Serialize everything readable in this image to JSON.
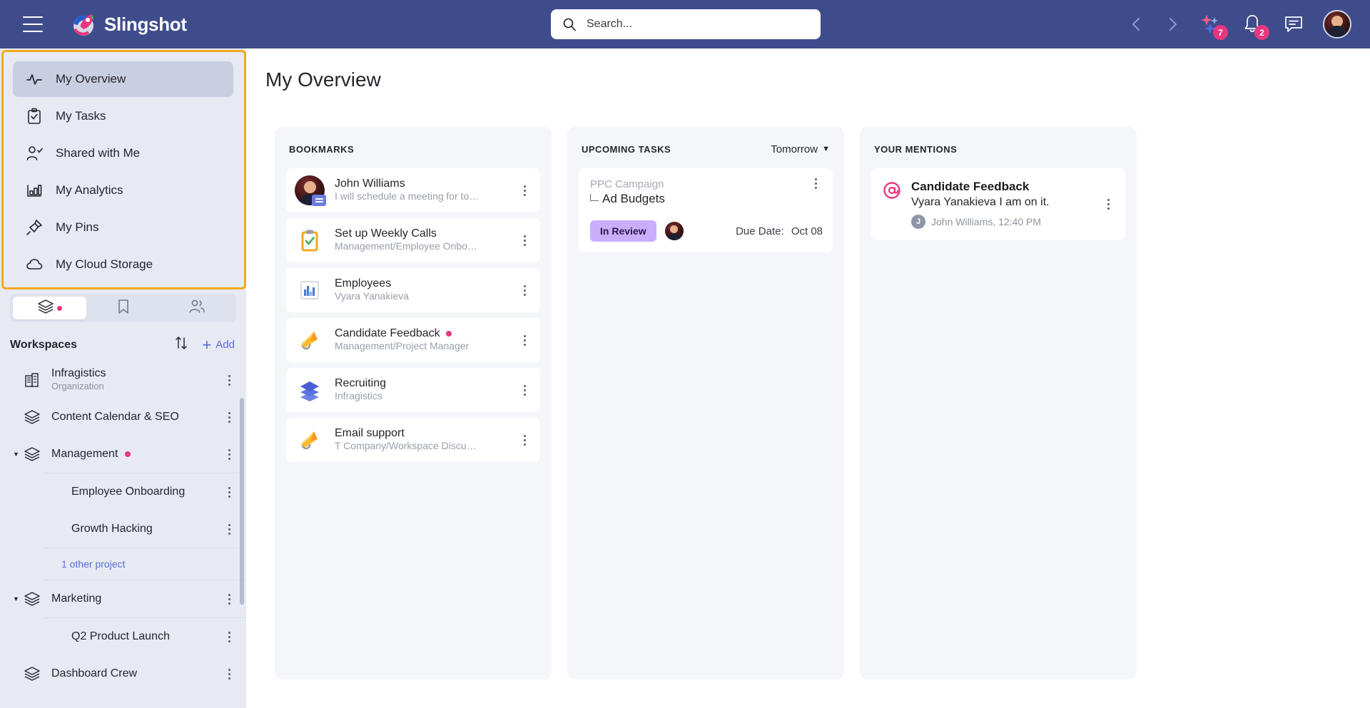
{
  "header": {
    "brand": "Slingshot",
    "menu_icon": "hamburger-icon",
    "search_placeholder": "Search...",
    "ai_badge": "7",
    "notification_badge": "2"
  },
  "sidebar": {
    "nav_items": [
      {
        "label": "My Overview",
        "icon": "activity-icon",
        "active": true
      },
      {
        "label": "My Tasks",
        "icon": "clipboard-check-icon",
        "active": false
      },
      {
        "label": "Shared with Me",
        "icon": "user-check-icon",
        "active": false
      },
      {
        "label": "My Analytics",
        "icon": "bar-chart-icon",
        "active": false
      },
      {
        "label": "My Pins",
        "icon": "pin-icon",
        "active": false
      },
      {
        "label": "My Cloud Storage",
        "icon": "cloud-icon",
        "active": false
      }
    ],
    "tabs": [
      {
        "name": "workspaces-tab",
        "icon": "layers-icon",
        "active": true,
        "dot": true
      },
      {
        "name": "bookmarks-tab",
        "icon": "bookmark-icon",
        "active": false,
        "dot": false
      },
      {
        "name": "people-tab",
        "icon": "people-icon",
        "active": false,
        "dot": false
      }
    ],
    "workspaces_label": "Workspaces",
    "add_label": "Add",
    "other_project_label": "1 other project",
    "workspaces": [
      {
        "name": "Infragistics",
        "sub": "Organization",
        "icon": "building-icon",
        "caret": false,
        "dot": false,
        "sub_level": false
      },
      {
        "name": "Content Calendar & SEO",
        "sub": "",
        "icon": "layers-icon",
        "caret": false,
        "dot": false,
        "sub_level": false
      },
      {
        "name": "Management",
        "sub": "",
        "icon": "layers-icon",
        "caret": true,
        "dot": true,
        "sub_level": false
      },
      {
        "name": "Employee Onboarding",
        "sub": "",
        "icon": "",
        "caret": false,
        "dot": false,
        "sub_level": true
      },
      {
        "name": "Growth Hacking",
        "sub": "",
        "icon": "",
        "caret": false,
        "dot": false,
        "sub_level": true
      },
      {
        "name": "Marketing",
        "sub": "",
        "icon": "layers-icon",
        "caret": true,
        "dot": false,
        "sub_level": false
      },
      {
        "name": "Q2 Product Launch",
        "sub": "",
        "icon": "",
        "caret": false,
        "dot": false,
        "sub_level": true
      },
      {
        "name": "Dashboard Crew",
        "sub": "",
        "icon": "layers-icon",
        "caret": false,
        "dot": false,
        "sub_level": false
      }
    ]
  },
  "main": {
    "page_title": "My Overview",
    "bookmarks": {
      "title": "BOOKMARKS",
      "items": [
        {
          "name": "John Williams",
          "sub": "I will schedule a meeting for to…",
          "icon": "user-avatar-message-icon",
          "dot": false
        },
        {
          "name": "Set up Weekly Calls",
          "sub": "Management/Employee Onbo…",
          "icon": "clipboard-task-icon",
          "dot": false
        },
        {
          "name": "Employees",
          "sub": "Vyara Yanakieva",
          "icon": "bar-chart-report-icon",
          "dot": false
        },
        {
          "name": "Candidate Feedback",
          "sub": "Management/Project Manager",
          "icon": "megaphone-icon",
          "dot": true
        },
        {
          "name": "Recruiting",
          "sub": "Infragistics",
          "icon": "layers-workspace-icon",
          "dot": false
        },
        {
          "name": "Email support",
          "sub": "T Company/Workspace Discu…",
          "icon": "megaphone-icon",
          "dot": false
        }
      ]
    },
    "upcoming_tasks": {
      "title": "UPCOMING TASKS",
      "filter": "Tomorrow",
      "task": {
        "parent": "PPC Campaign",
        "name": "Ad Budgets",
        "status": "In Review",
        "due_label": "Due Date:",
        "due_value": "Oct 08"
      }
    },
    "mentions": {
      "title": "YOUR MENTIONS",
      "item": {
        "title": "Candidate Feedback",
        "text": "Vyara Yanakieva I am on it.",
        "author_initial": "J",
        "author_meta": "John Williams, 12:40 PM"
      }
    }
  },
  "colors": {
    "header_bg": "#3f4c8c",
    "sidebar_bg": "#e7eaf3",
    "highlight_border": "#f0a91e",
    "accent_pink": "#e8377f",
    "accent_blue": "#5a6bd6",
    "status_badge_bg": "#c9aefc"
  }
}
